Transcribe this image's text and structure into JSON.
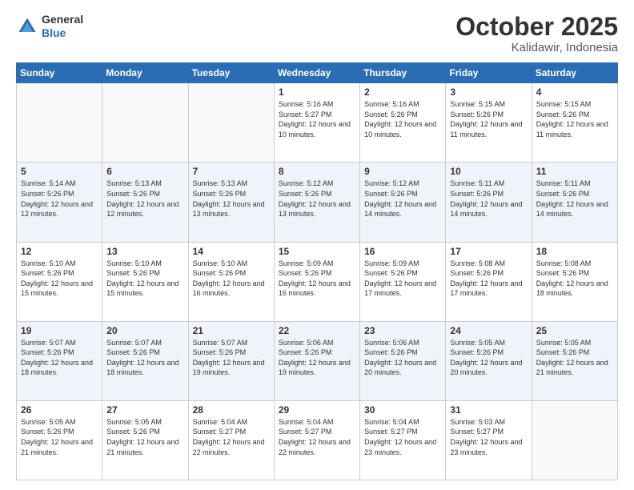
{
  "logo": {
    "general": "General",
    "blue": "Blue"
  },
  "header": {
    "month": "October 2025",
    "location": "Kalidawir, Indonesia"
  },
  "weekdays": [
    "Sunday",
    "Monday",
    "Tuesday",
    "Wednesday",
    "Thursday",
    "Friday",
    "Saturday"
  ],
  "weeks": [
    [
      {
        "day": "",
        "sunrise": "",
        "sunset": "",
        "daylight": ""
      },
      {
        "day": "",
        "sunrise": "",
        "sunset": "",
        "daylight": ""
      },
      {
        "day": "",
        "sunrise": "",
        "sunset": "",
        "daylight": ""
      },
      {
        "day": "1",
        "sunrise": "Sunrise: 5:16 AM",
        "sunset": "Sunset: 5:27 PM",
        "daylight": "Daylight: 12 hours and 10 minutes."
      },
      {
        "day": "2",
        "sunrise": "Sunrise: 5:16 AM",
        "sunset": "Sunset: 5:26 PM",
        "daylight": "Daylight: 12 hours and 10 minutes."
      },
      {
        "day": "3",
        "sunrise": "Sunrise: 5:15 AM",
        "sunset": "Sunset: 5:26 PM",
        "daylight": "Daylight: 12 hours and 11 minutes."
      },
      {
        "day": "4",
        "sunrise": "Sunrise: 5:15 AM",
        "sunset": "Sunset: 5:26 PM",
        "daylight": "Daylight: 12 hours and 11 minutes."
      }
    ],
    [
      {
        "day": "5",
        "sunrise": "Sunrise: 5:14 AM",
        "sunset": "Sunset: 5:26 PM",
        "daylight": "Daylight: 12 hours and 12 minutes."
      },
      {
        "day": "6",
        "sunrise": "Sunrise: 5:13 AM",
        "sunset": "Sunset: 5:26 PM",
        "daylight": "Daylight: 12 hours and 12 minutes."
      },
      {
        "day": "7",
        "sunrise": "Sunrise: 5:13 AM",
        "sunset": "Sunset: 5:26 PM",
        "daylight": "Daylight: 12 hours and 13 minutes."
      },
      {
        "day": "8",
        "sunrise": "Sunrise: 5:12 AM",
        "sunset": "Sunset: 5:26 PM",
        "daylight": "Daylight: 12 hours and 13 minutes."
      },
      {
        "day": "9",
        "sunrise": "Sunrise: 5:12 AM",
        "sunset": "Sunset: 5:26 PM",
        "daylight": "Daylight: 12 hours and 14 minutes."
      },
      {
        "day": "10",
        "sunrise": "Sunrise: 5:11 AM",
        "sunset": "Sunset: 5:26 PM",
        "daylight": "Daylight: 12 hours and 14 minutes."
      },
      {
        "day": "11",
        "sunrise": "Sunrise: 5:11 AM",
        "sunset": "Sunset: 5:26 PM",
        "daylight": "Daylight: 12 hours and 14 minutes."
      }
    ],
    [
      {
        "day": "12",
        "sunrise": "Sunrise: 5:10 AM",
        "sunset": "Sunset: 5:26 PM",
        "daylight": "Daylight: 12 hours and 15 minutes."
      },
      {
        "day": "13",
        "sunrise": "Sunrise: 5:10 AM",
        "sunset": "Sunset: 5:26 PM",
        "daylight": "Daylight: 12 hours and 15 minutes."
      },
      {
        "day": "14",
        "sunrise": "Sunrise: 5:10 AM",
        "sunset": "Sunset: 5:26 PM",
        "daylight": "Daylight: 12 hours and 16 minutes."
      },
      {
        "day": "15",
        "sunrise": "Sunrise: 5:09 AM",
        "sunset": "Sunset: 5:26 PM",
        "daylight": "Daylight: 12 hours and 16 minutes."
      },
      {
        "day": "16",
        "sunrise": "Sunrise: 5:09 AM",
        "sunset": "Sunset: 5:26 PM",
        "daylight": "Daylight: 12 hours and 17 minutes."
      },
      {
        "day": "17",
        "sunrise": "Sunrise: 5:08 AM",
        "sunset": "Sunset: 5:26 PM",
        "daylight": "Daylight: 12 hours and 17 minutes."
      },
      {
        "day": "18",
        "sunrise": "Sunrise: 5:08 AM",
        "sunset": "Sunset: 5:26 PM",
        "daylight": "Daylight: 12 hours and 18 minutes."
      }
    ],
    [
      {
        "day": "19",
        "sunrise": "Sunrise: 5:07 AM",
        "sunset": "Sunset: 5:26 PM",
        "daylight": "Daylight: 12 hours and 18 minutes."
      },
      {
        "day": "20",
        "sunrise": "Sunrise: 5:07 AM",
        "sunset": "Sunset: 5:26 PM",
        "daylight": "Daylight: 12 hours and 18 minutes."
      },
      {
        "day": "21",
        "sunrise": "Sunrise: 5:07 AM",
        "sunset": "Sunset: 5:26 PM",
        "daylight": "Daylight: 12 hours and 19 minutes."
      },
      {
        "day": "22",
        "sunrise": "Sunrise: 5:06 AM",
        "sunset": "Sunset: 5:26 PM",
        "daylight": "Daylight: 12 hours and 19 minutes."
      },
      {
        "day": "23",
        "sunrise": "Sunrise: 5:06 AM",
        "sunset": "Sunset: 5:26 PM",
        "daylight": "Daylight: 12 hours and 20 minutes."
      },
      {
        "day": "24",
        "sunrise": "Sunrise: 5:05 AM",
        "sunset": "Sunset: 5:26 PM",
        "daylight": "Daylight: 12 hours and 20 minutes."
      },
      {
        "day": "25",
        "sunrise": "Sunrise: 5:05 AM",
        "sunset": "Sunset: 5:26 PM",
        "daylight": "Daylight: 12 hours and 21 minutes."
      }
    ],
    [
      {
        "day": "26",
        "sunrise": "Sunrise: 5:05 AM",
        "sunset": "Sunset: 5:26 PM",
        "daylight": "Daylight: 12 hours and 21 minutes."
      },
      {
        "day": "27",
        "sunrise": "Sunrise: 5:05 AM",
        "sunset": "Sunset: 5:26 PM",
        "daylight": "Daylight: 12 hours and 21 minutes."
      },
      {
        "day": "28",
        "sunrise": "Sunrise: 5:04 AM",
        "sunset": "Sunset: 5:27 PM",
        "daylight": "Daylight: 12 hours and 22 minutes."
      },
      {
        "day": "29",
        "sunrise": "Sunrise: 5:04 AM",
        "sunset": "Sunset: 5:27 PM",
        "daylight": "Daylight: 12 hours and 22 minutes."
      },
      {
        "day": "30",
        "sunrise": "Sunrise: 5:04 AM",
        "sunset": "Sunset: 5:27 PM",
        "daylight": "Daylight: 12 hours and 23 minutes."
      },
      {
        "day": "31",
        "sunrise": "Sunrise: 5:03 AM",
        "sunset": "Sunset: 5:27 PM",
        "daylight": "Daylight: 12 hours and 23 minutes."
      },
      {
        "day": "",
        "sunrise": "",
        "sunset": "",
        "daylight": ""
      }
    ]
  ]
}
